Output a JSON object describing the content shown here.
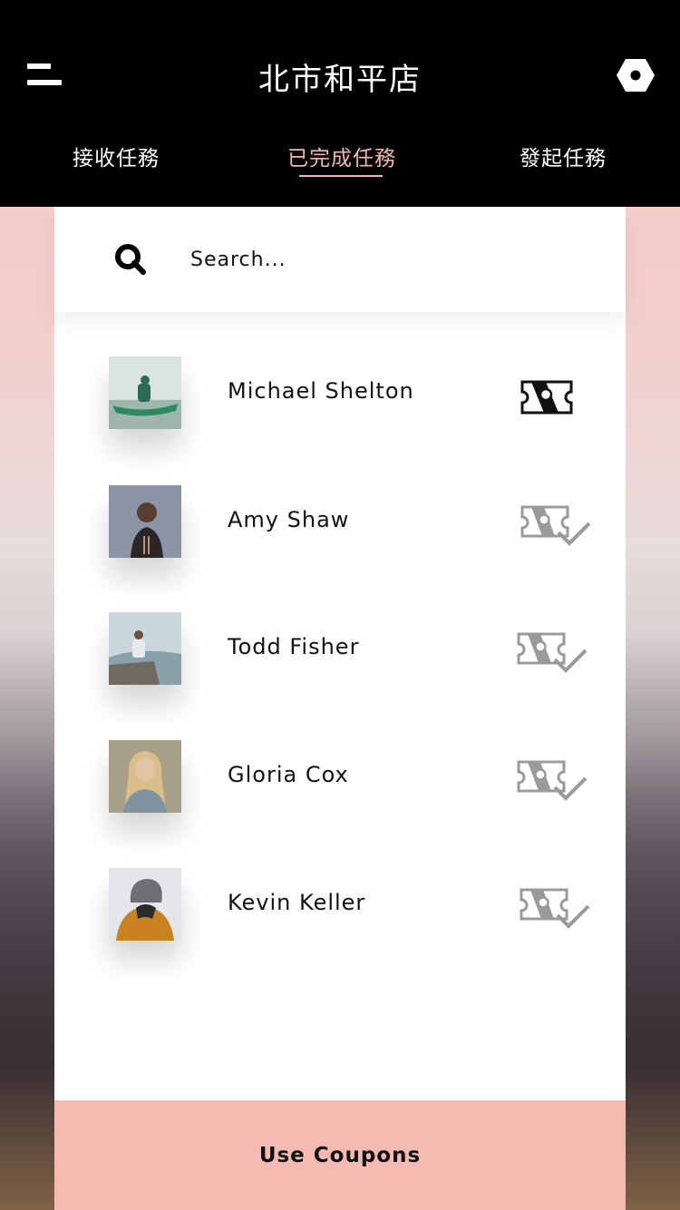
{
  "header": {
    "title": "北市和平店",
    "menu_icon": "menu-icon",
    "settings_icon": "hex-nut-icon"
  },
  "tabs": [
    {
      "label": "接收任務",
      "active": false
    },
    {
      "label": "已完成任務",
      "active": true
    },
    {
      "label": "發起任務",
      "active": false
    }
  ],
  "search": {
    "placeholder": "Search...",
    "icon": "search-icon"
  },
  "contacts": [
    {
      "name": "Michael Shelton",
      "status_icon": "coupon-active-icon"
    },
    {
      "name": "Amy Shaw",
      "status_icon": "coupon-used-check-icon"
    },
    {
      "name": "Todd Fisher",
      "status_icon": "coupon-used-check-icon"
    },
    {
      "name": "Gloria Cox",
      "status_icon": "coupon-used-check-icon"
    },
    {
      "name": "Kevin Keller",
      "status_icon": "coupon-used-check-icon"
    }
  ],
  "footer": {
    "button_label": "Use Coupons"
  },
  "colors": {
    "accent": "#f6b6ae",
    "footer_bg": "#f7bab3",
    "topbar_bg": "#000000"
  }
}
